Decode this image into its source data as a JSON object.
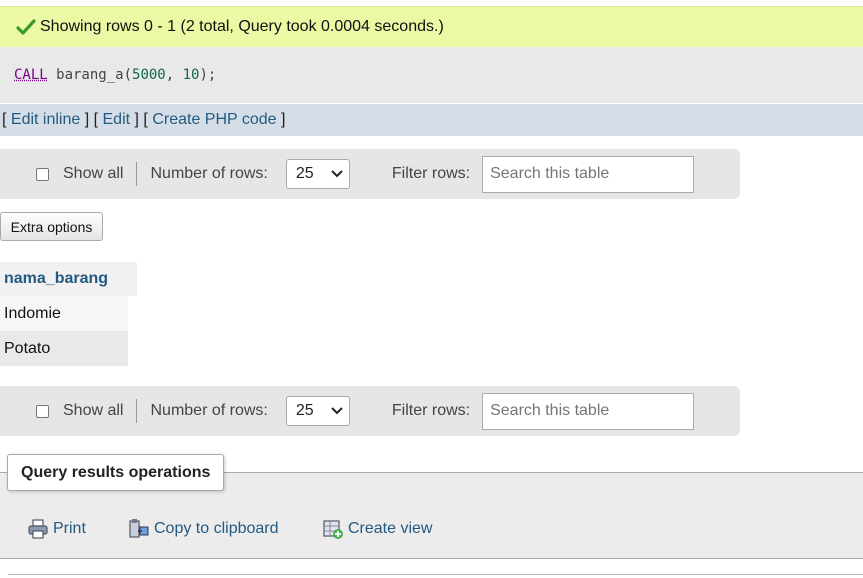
{
  "status": {
    "message": "Showing rows 0 - 1 (2 total, Query took 0.0004 seconds.)",
    "icon": "success-check-icon",
    "color": "#ebf8a4"
  },
  "sql": {
    "keyword": "CALL",
    "proc": " barang_a(",
    "arg1": "5000",
    "comma": ", ",
    "arg2": "10",
    "close": ");"
  },
  "links": {
    "open1": "[ ",
    "edit_inline": "Edit inline",
    "mid1": " ] [ ",
    "edit": "Edit",
    "mid2": " ] [ ",
    "create_php": "Create PHP code",
    "close": " ]"
  },
  "nav": {
    "show_all": "Show all",
    "rows_label": "Number of rows:",
    "rows_value": "25",
    "filter_label": "Filter rows:",
    "search_placeholder": "Search this table"
  },
  "extra_options": "Extra options",
  "table": {
    "column": "nama_barang",
    "rows": [
      "Indomie",
      "Potato"
    ]
  },
  "operations": {
    "title": "Query results operations",
    "print": "Print",
    "copy": "Copy to clipboard",
    "create_view": "Create view"
  },
  "colors": {
    "link": "#235a81",
    "keyword": "#770088",
    "number": "#116644"
  }
}
